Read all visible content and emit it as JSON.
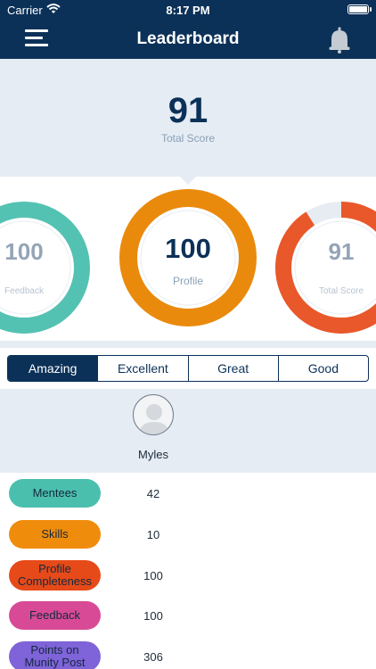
{
  "status_bar": {
    "carrier": "Carrier",
    "time": "8:17 PM"
  },
  "nav": {
    "title": "Leaderboard",
    "menu_icon": "hamburger-menu-icon",
    "bell_icon": "bell-icon"
  },
  "total": {
    "value": "91",
    "label": "Total Score"
  },
  "rings": {
    "left": {
      "value": "100",
      "label": "Feedback",
      "fraction": 1.0,
      "color": "#4bbfae"
    },
    "center": {
      "value": "100",
      "label": "Profile",
      "fraction": 1.0,
      "color": "#ea8a0c"
    },
    "right": {
      "value": "91",
      "label": "Total Score",
      "fraction": 0.91,
      "color": "#e8501f"
    }
  },
  "tabs": [
    {
      "label": "Amazing",
      "active": true
    },
    {
      "label": "Excellent",
      "active": false
    },
    {
      "label": "Great",
      "active": false
    },
    {
      "label": "Good",
      "active": false
    }
  ],
  "user": {
    "name": "Myles",
    "avatar_icon": "user-avatar-icon"
  },
  "stats": [
    {
      "label": "Mentees",
      "value": "42",
      "color": "#4bbfae"
    },
    {
      "label": "Skills",
      "value": "10",
      "color": "#f08c0c"
    },
    {
      "label": "Profile Completeness",
      "value": "100",
      "color": "#e64a18"
    },
    {
      "label": "Feedback",
      "value": "100",
      "color": "#d84a96"
    },
    {
      "label": "Points on Munity Post",
      "value": "306",
      "color": "#7f63d8"
    }
  ],
  "colors": {
    "navy": "#0c3158",
    "panel": "#e5ecf4"
  }
}
